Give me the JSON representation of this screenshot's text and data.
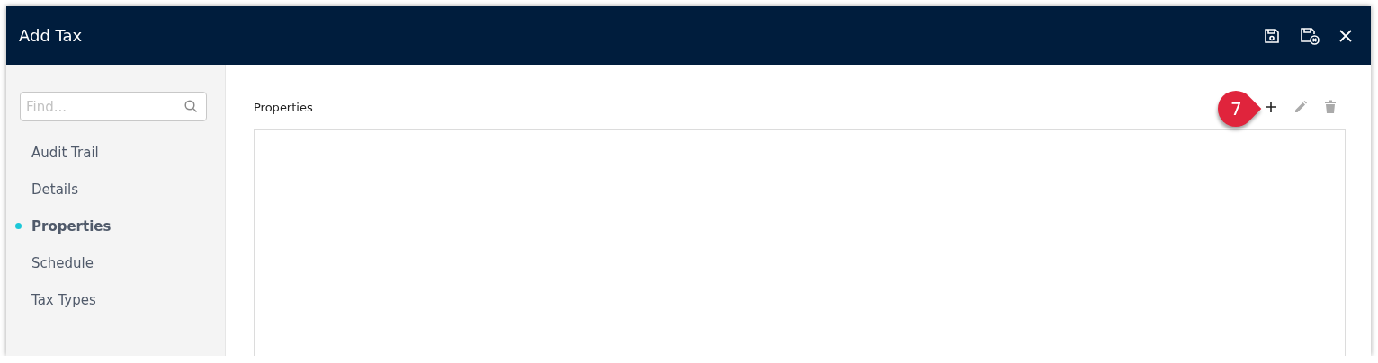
{
  "window": {
    "title": "Add Tax"
  },
  "sidebar": {
    "search": {
      "placeholder": "Find..."
    },
    "items": [
      {
        "label": "Audit Trail",
        "selected": false
      },
      {
        "label": "Details",
        "selected": false
      },
      {
        "label": "Properties",
        "selected": true
      },
      {
        "label": "Schedule",
        "selected": false
      },
      {
        "label": "Tax Types",
        "selected": false
      }
    ]
  },
  "section": {
    "title": "Properties",
    "callout": "7"
  }
}
